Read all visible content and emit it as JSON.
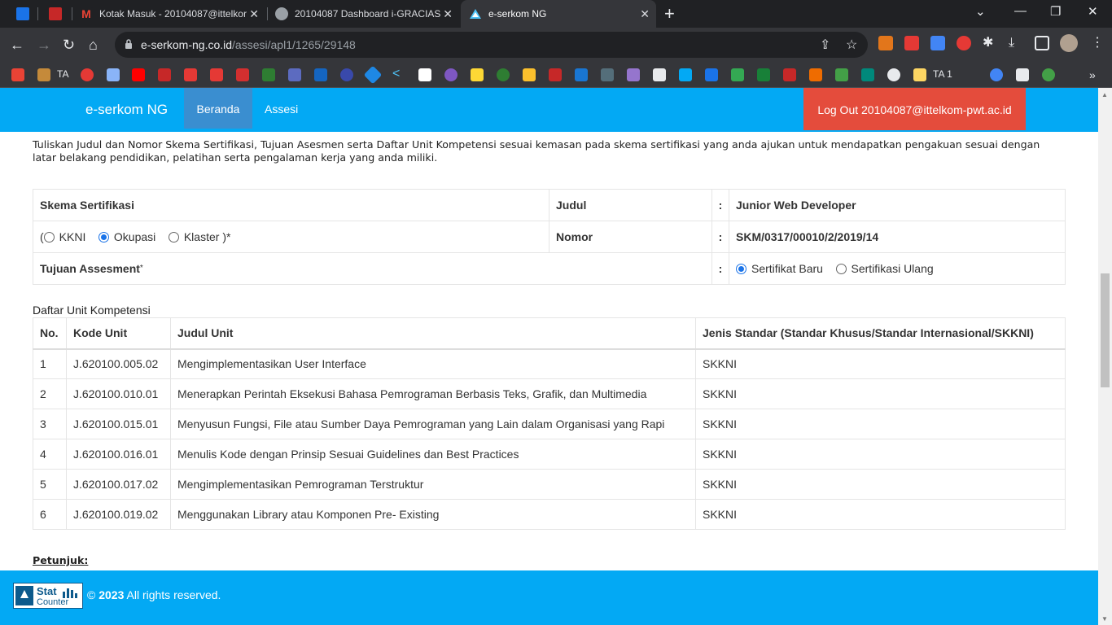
{
  "browser": {
    "tabs": [
      {
        "title": "",
        "favicon": "calendar-icon",
        "color": "#1a73e8"
      },
      {
        "title": "",
        "favicon": "telkom-icon",
        "color": "#e53935"
      },
      {
        "title": "Kotak Masuk - 20104087@ittelkor",
        "favicon": "gmail-icon",
        "color": "#ea4335"
      },
      {
        "title": "20104087 Dashboard i-GRACIAS |",
        "favicon": "globe-icon",
        "color": "#9aa0a6"
      },
      {
        "title": "e-serkom NG",
        "favicon": "eserkom-icon",
        "color": "#4fc3f7"
      }
    ],
    "new_tab_label": "+",
    "address": {
      "host": "e-serkom-ng.co.id",
      "path": "/assesi/apl1/1265/29148"
    },
    "bookmarks": {
      "ta_label": "TA",
      "ta1_label": "TA 1"
    }
  },
  "site": {
    "brand": "e-serkom NG",
    "nav": {
      "home": "Beranda",
      "assesi": "Assesi"
    },
    "logout": "Log Out 20104087@ittelkom-pwt.ac.id"
  },
  "form": {
    "intro": "Tuliskan Judul dan Nomor Skema Sertifikasi, Tujuan Asesmen serta Daftar Unit Kompetensi sesuai kemasan pada skema sertifikasi yang anda ajukan untuk mendapatkan pengakuan sesuai dengan latar belakang pendidikan, pelatihan serta pengalaman kerja yang anda miliki.",
    "skema_label": "Skema Sertifikasi",
    "judul_label": "Judul",
    "colon": ":",
    "judul_value": "Junior Web Developer",
    "paren_open": "(",
    "paren_close": ")*",
    "radio_kkni": "KKNI",
    "radio_okupasi": "Okupasi",
    "radio_klaster": "Klaster",
    "nomor_label": "Nomor",
    "nomor_value": "SKM/0317/00010/2/2019/14",
    "tujuan_label": "Tujuan Assesment",
    "required_mark": "*",
    "radio_baru": "Sertifikat Baru",
    "radio_ulang": "Sertifikasi Ulang",
    "units_title": "Daftar Unit Kompetensi",
    "units_headers": [
      "No.",
      "Kode Unit",
      "Judul Unit",
      "Jenis Standar (Standar Khusus/Standar Internasional/SKKNI)"
    ],
    "units": [
      [
        "1",
        "J.620100.005.02",
        "Mengimplementasikan User Interface",
        "SKKNI"
      ],
      [
        "2",
        "J.620100.010.01",
        "Menerapkan Perintah Eksekusi Bahasa Pemrograman Berbasis Teks, Grafik, dan Multimedia",
        "SKKNI"
      ],
      [
        "3",
        "J.620100.015.01",
        "Menyusun Fungsi, File atau Sumber Daya Pemrograman yang Lain dalam Organisasi yang Rapi",
        "SKKNI"
      ],
      [
        "4",
        "J.620100.016.01",
        "Menulis Kode dengan Prinsip Sesuai Guidelines dan Best Practices",
        "SKKNI"
      ],
      [
        "5",
        "J.620100.017.02",
        "Mengimplementasikan Pemrograman Terstruktur",
        "SKKNI"
      ],
      [
        "6",
        "J.620100.019.02",
        "Menggunakan Library atau Komponen Pre- Existing",
        "SKKNI"
      ]
    ],
    "petunjuk": "Petunjuk:"
  },
  "footer": {
    "statcounter_top": "Stat",
    "statcounter_bottom": "Counter",
    "copyright_symbol": "©",
    "year": "2023",
    "rights": "All rights reserved."
  }
}
